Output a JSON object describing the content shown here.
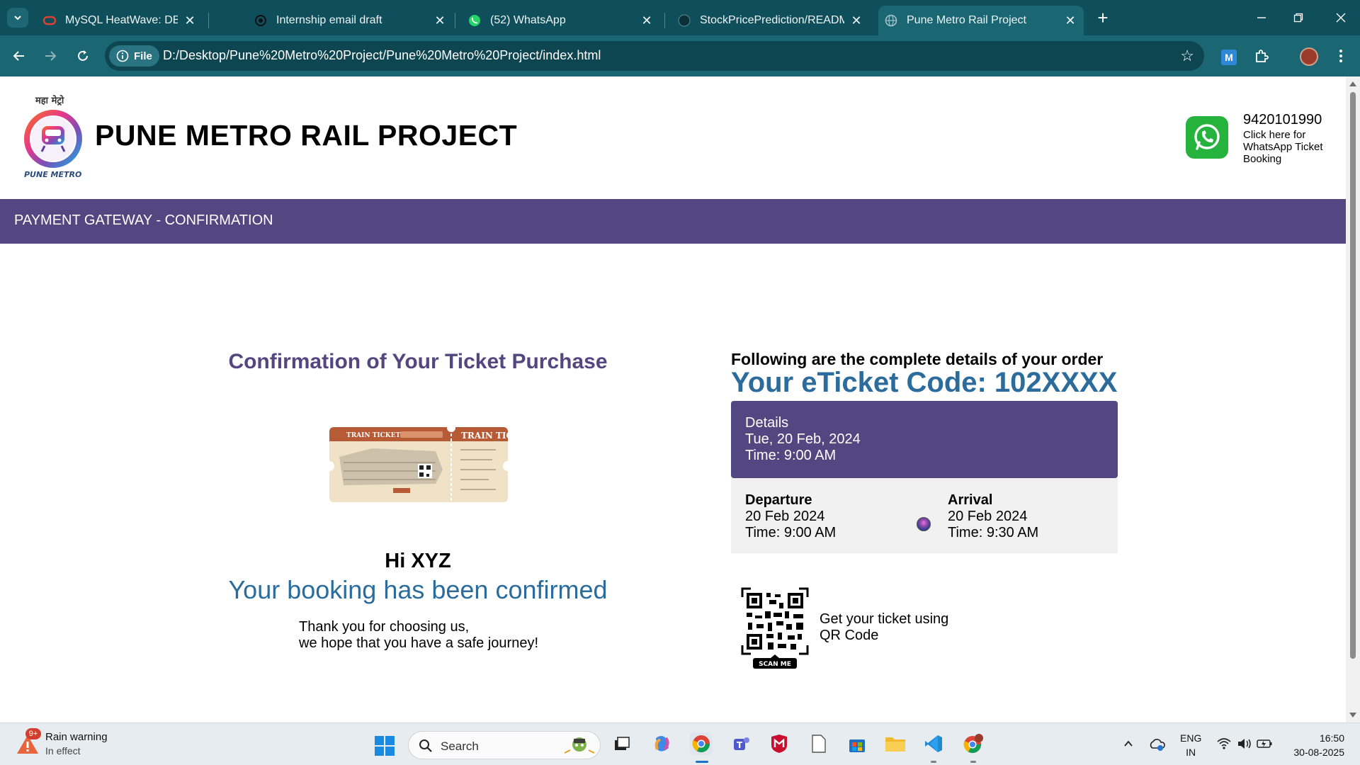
{
  "browser": {
    "tabs": [
      {
        "title": "MySQL HeatWave: DB System E",
        "icon": "oracle-icon"
      },
      {
        "title": "Internship email draft",
        "icon": "chatgpt-icon"
      },
      {
        "title": "(52) WhatsApp",
        "icon": "whatsapp-icon"
      },
      {
        "title": "StockPricePrediction/README.n",
        "icon": "github-icon"
      },
      {
        "title": "Pune Metro Rail Project",
        "icon": "globe-icon",
        "active": true
      }
    ],
    "new_tab": "+",
    "chip": "File",
    "url": "D:/Desktop/Pune%20Metro%20Project/Pune%20Metro%20Project/index.html",
    "extension_label": "M"
  },
  "header": {
    "title": "PUNE METRO RAIL PROJECT",
    "logo_text_top": "महा मेट्रो",
    "logo_text_bottom": "PUNE METRO",
    "whatsapp_phone": "9420101990",
    "whatsapp_link": "Click here for WhatsApp Ticket Booking"
  },
  "nav": {
    "title": "PAYMENT GATEWAY - CONFIRMATION"
  },
  "left": {
    "heading": "Confirmation of Your Ticket Purchase",
    "ticket_label_1": "TRAIN TICKET",
    "ticket_label_2": "TRAIN TIC",
    "greeting": "Hi XYZ",
    "confirmed": "Your booking has been confirmed",
    "thanks_line1": "Thank you for choosing us,",
    "thanks_line2": "we hope that you have a safe journey!"
  },
  "order": {
    "heading": "Following are the complete details of your order",
    "eticket": "Your eTicket Code: 102XXXX",
    "details_title": "Details",
    "details_date": "Tue, 20 Feb, 2024",
    "details_time": "Time: 9:00 AM",
    "departure_label": "Departure",
    "departure_date": "20 Feb 2024",
    "departure_time": "Time: 9:00 AM",
    "arrival_label": "Arrival",
    "arrival_date": "20 Feb 2024",
    "arrival_time": "Time: 9:30 AM",
    "qr_caption": "SCAN ME",
    "qr_line1": "Get your ticket using",
    "qr_line2": "QR Code"
  },
  "taskbar": {
    "weather_badge": "9+",
    "weather_title": "Rain warning",
    "weather_sub": "In effect",
    "search_placeholder": "Search",
    "lang_line1": "ENG",
    "lang_line2": "IN",
    "time": "16:50",
    "date": "30-08-2025"
  },
  "colors": {
    "chrome_dark": "#0f4f5c",
    "chrome_toolbar": "#1b6673",
    "brand_purple": "#524780",
    "accent_blue": "#2b6c9c",
    "whatsapp_green": "#25b33e"
  }
}
